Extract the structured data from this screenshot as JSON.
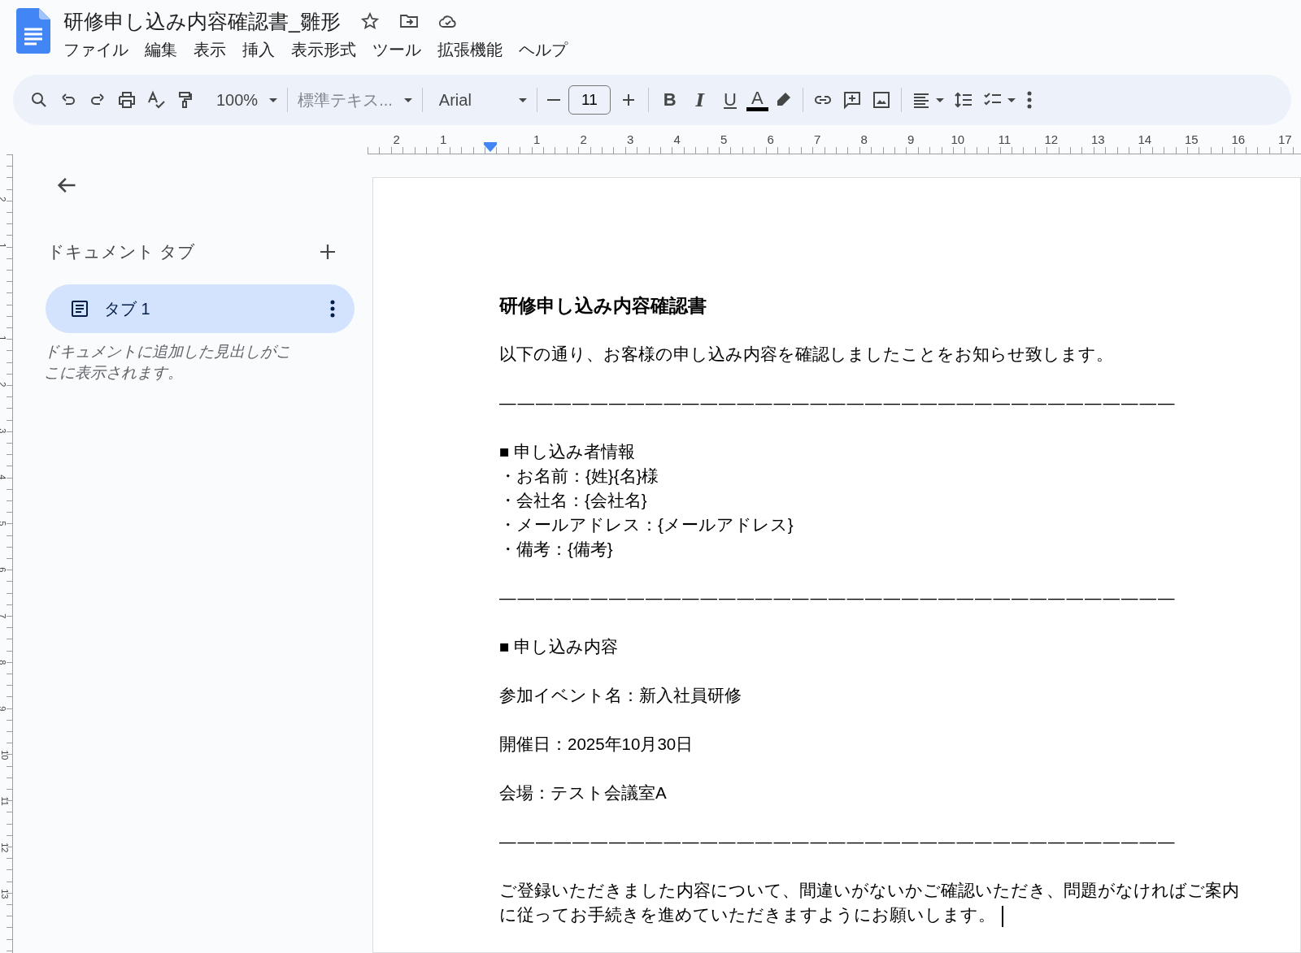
{
  "window": {
    "title": "研修申し込み内容確認書_雛形"
  },
  "menu": [
    "ファイル",
    "編集",
    "表示",
    "挿入",
    "表示形式",
    "ツール",
    "拡張機能",
    "ヘルプ"
  ],
  "toolbar": {
    "zoom": "100%",
    "style": "標準テキス...",
    "font": "Arial",
    "font_size": "11",
    "bold": "B",
    "italic": "I",
    "underline": "U",
    "text_color": "A"
  },
  "ruler": {
    "labels": [
      "2",
      "1",
      "1",
      "2",
      "3",
      "4",
      "5",
      "6",
      "7",
      "8",
      "9",
      "10",
      "11",
      "12",
      "13",
      "14",
      "15",
      "16",
      "17"
    ]
  },
  "vertical_ruler": {
    "labels": [
      "2",
      "1",
      "1",
      "2",
      "3",
      "4",
      "5",
      "6",
      "7",
      "8",
      "9",
      "10",
      "11",
      "12",
      "13"
    ]
  },
  "sidebar": {
    "title": "ドキュメント タブ",
    "tabs": [
      {
        "label": "タブ 1",
        "selected": true
      }
    ],
    "hint": "ドキュメントに追加した見出しがここに表示されます。"
  },
  "document": {
    "blocks": [
      {
        "kind": "title",
        "text": "研修申し込み内容確認書"
      },
      {
        "kind": "para",
        "text": "以下の通り、お客様の申し込み内容を確認しましたことをお知らせ致します。"
      },
      {
        "kind": "divider",
        "text": "—————————————————————————————————————"
      },
      {
        "kind": "heading",
        "text": "■ 申し込み者情報"
      },
      {
        "kind": "item",
        "text": "・お名前：{姓}{名}様"
      },
      {
        "kind": "item",
        "text": "・会社名：{会社名}"
      },
      {
        "kind": "item",
        "text": "・メールアドレス：{メールアドレス}"
      },
      {
        "kind": "item",
        "text": "・備考：{備考}"
      },
      {
        "kind": "divider",
        "text": "—————————————————————————————————————"
      },
      {
        "kind": "heading",
        "text": "■ 申し込み内容"
      },
      {
        "kind": "para",
        "text": "参加イベント名：新入社員研修"
      },
      {
        "kind": "para",
        "text": "開催日：2025年10月30日"
      },
      {
        "kind": "para",
        "text": "会場：テスト会議室A"
      },
      {
        "kind": "divider",
        "text": "—————————————————————————————————————"
      },
      {
        "kind": "para",
        "text": "ご登録いただきました内容について、間違いがないかご確認いただき、問題がなければご案内に従ってお手続きを進めていただきますようにお願いします。"
      }
    ]
  }
}
